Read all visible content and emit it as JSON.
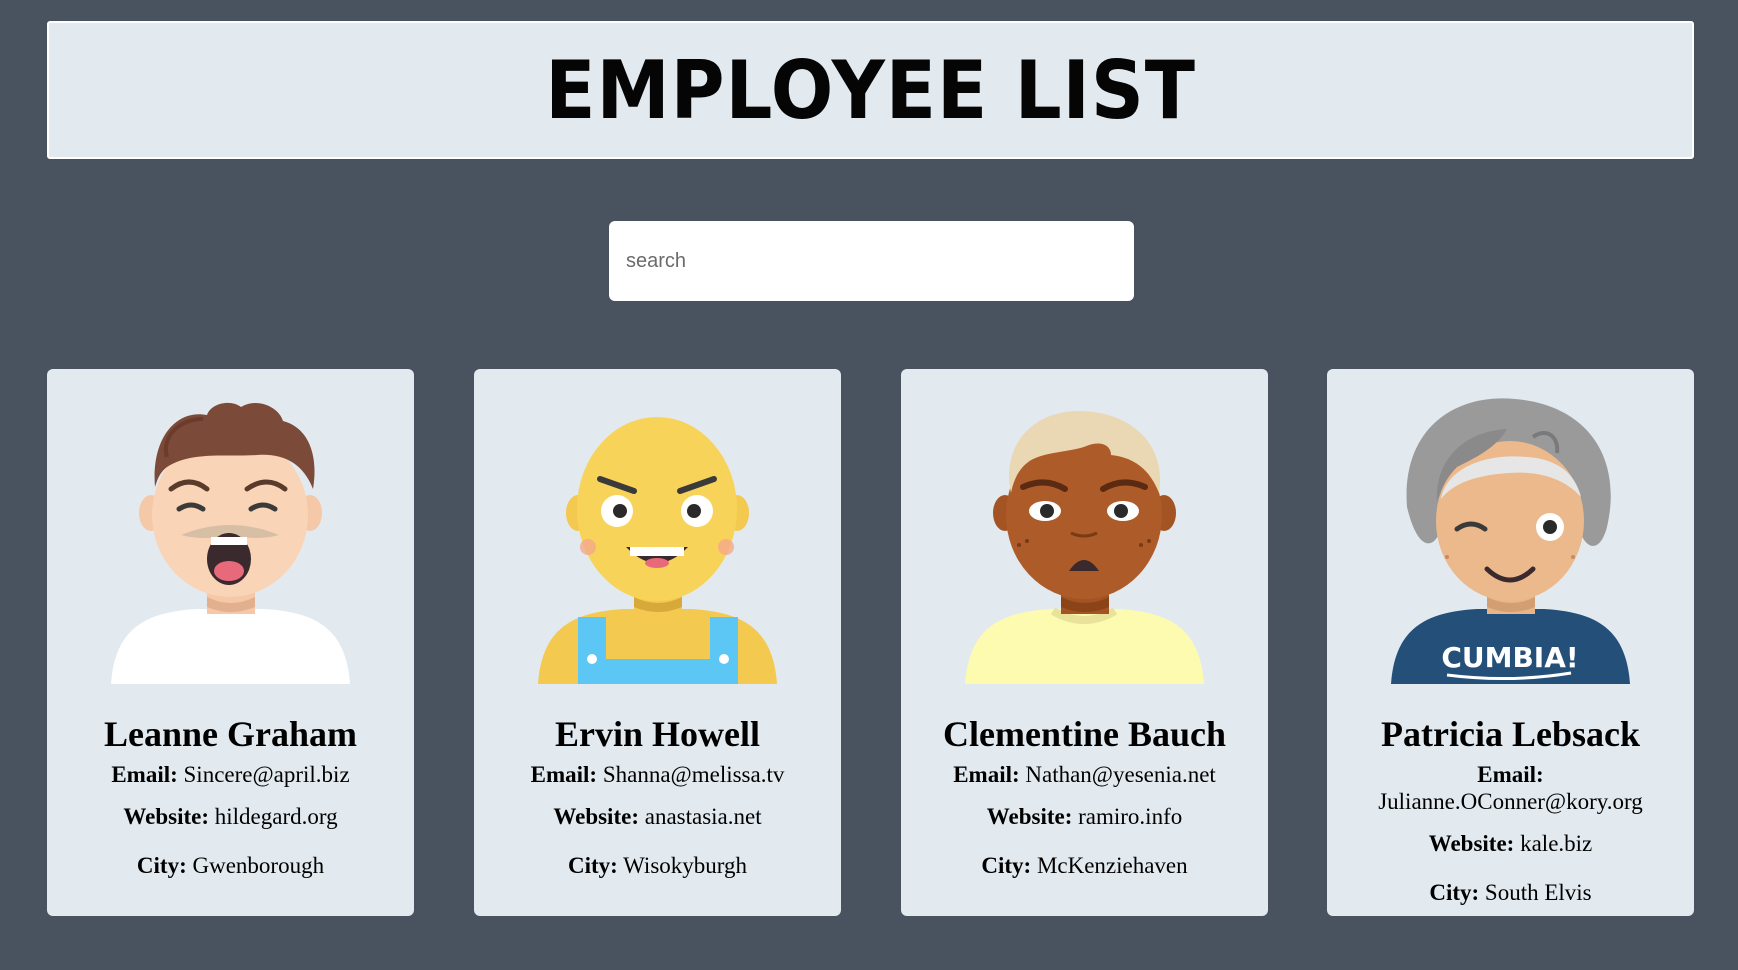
{
  "header": {
    "title": "EMPLOYEE LIST"
  },
  "search": {
    "placeholder": "search",
    "value": ""
  },
  "labels": {
    "email": "Email:",
    "website": "Website:",
    "city": "City:"
  },
  "employees": [
    {
      "name": "Leanne Graham",
      "email": "Sincere@april.biz",
      "website": "hildegard.org",
      "city": "Gwenborough",
      "avatar": "man-surprised-avatar"
    },
    {
      "name": "Ervin Howell",
      "email": "Shanna@melissa.tv",
      "website": "anastasia.net",
      "city": "Wisokyburgh",
      "avatar": "bald-overalls-avatar"
    },
    {
      "name": "Clementine Bauch",
      "email": "Nathan@yesenia.net",
      "website": "ramiro.info",
      "city": "McKenziehaven",
      "avatar": "dark-skin-frown-avatar"
    },
    {
      "name": "Patricia Lebsack",
      "email": "Julianne.OConner@kory.org",
      "website": "kale.biz",
      "city": "South Elvis",
      "avatar": "gray-hair-wink-avatar",
      "shirt_text": "CUMBIA!"
    }
  ]
}
